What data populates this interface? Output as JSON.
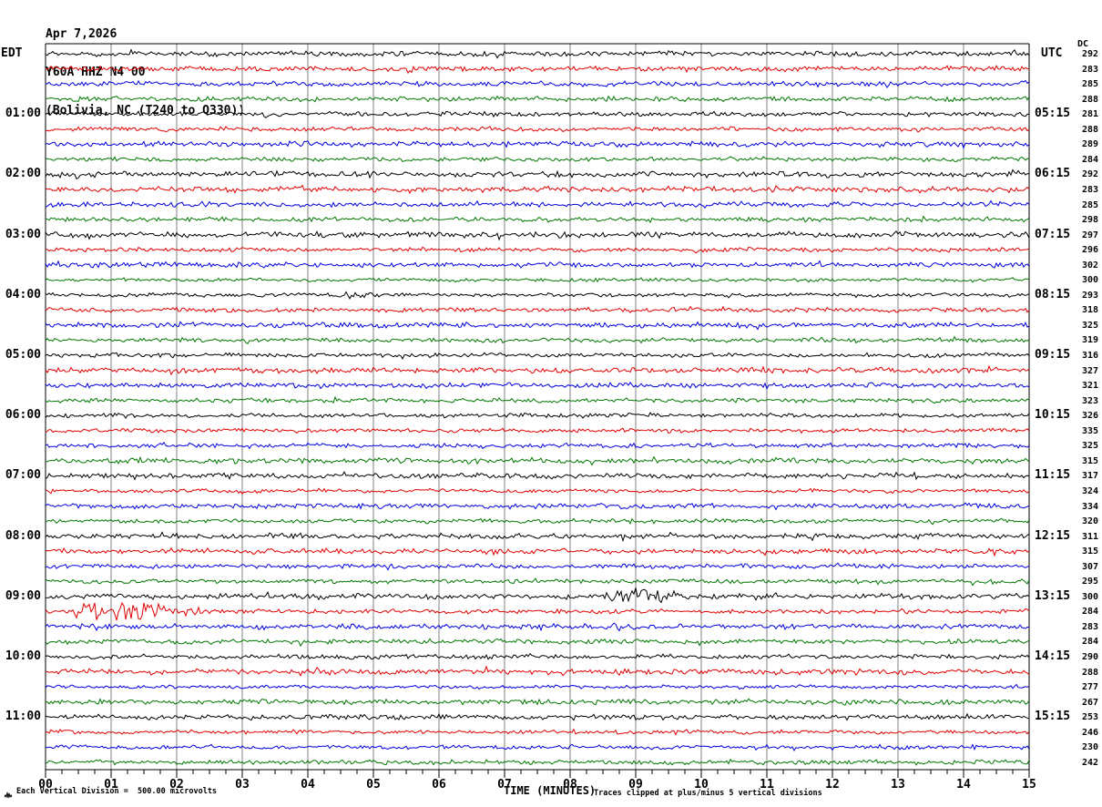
{
  "header": {
    "date_line": "Apr 7,2026",
    "station_line": "Y60A HHZ N4 00",
    "location_line": "(Bolivia, NC (T240 to Q330))",
    "left_timezone": "EDT",
    "right_timezone": "UTC",
    "dc_column_label": "DC"
  },
  "x_axis": {
    "label": "TIME (MINUTES)",
    "tick_labels": [
      "00",
      "01",
      "02",
      "03",
      "04",
      "05",
      "06",
      "07",
      "08",
      "09",
      "10",
      "11",
      "12",
      "13",
      "14",
      "15"
    ]
  },
  "footer": {
    "scale_note": "Each Vertical Division =  500.00 microvolts",
    "clip_note": "Traces clipped at plus/minus 5 vertical divisions"
  },
  "chart_data": {
    "type": "line",
    "title": "Helicorder record Y60A HHZ N4 00 (Bolivia, NC) - Apr 7, 2026",
    "x_unit": "minutes",
    "x_range": [
      0,
      15
    ],
    "minutes_per_row": 15,
    "row_count": 48,
    "first_row_start_edt": "00:00",
    "left_time_labels": [
      "01:00",
      "02:00",
      "03:00",
      "04:00",
      "05:00",
      "06:00",
      "07:00",
      "08:00",
      "09:00",
      "10:00",
      "11:00"
    ],
    "right_time_labels": [
      "05:15",
      "06:15",
      "07:15",
      "08:15",
      "09:15",
      "10:15",
      "11:15",
      "12:15",
      "13:15",
      "14:15",
      "15:15"
    ],
    "first_labeled_row": 5,
    "label_row_interval": 4,
    "trace_color_cycle": [
      "#000000",
      "#e00000",
      "#0000dd",
      "#007700"
    ],
    "grid_color": "#808080",
    "dc_offsets": [
      292,
      283,
      285,
      288,
      281,
      288,
      289,
      284,
      292,
      283,
      285,
      298,
      297,
      296,
      302,
      300,
      293,
      318,
      325,
      319,
      316,
      327,
      321,
      323,
      326,
      335,
      325,
      315,
      317,
      324,
      334,
      320,
      311,
      315,
      307,
      295,
      300,
      284,
      283,
      284,
      290,
      288,
      277,
      267,
      253,
      246,
      230,
      242
    ],
    "events": [
      {
        "row": 17,
        "start_min": 4.55,
        "end_min": 5.05,
        "relative_amplitude": 1.6,
        "description": "small burst on 04:00 EDT trace"
      },
      {
        "row": 37,
        "start_min": 8.5,
        "end_min": 9.9,
        "relative_amplitude": 2.3,
        "description": "burst on 09:00 EDT trace"
      },
      {
        "row": 38,
        "start_min": 0.35,
        "end_min": 2.75,
        "relative_amplitude": 4.2,
        "description": "largest burst on 09:15 EDT trace (red)"
      }
    ],
    "noise_seed": 20260407
  }
}
